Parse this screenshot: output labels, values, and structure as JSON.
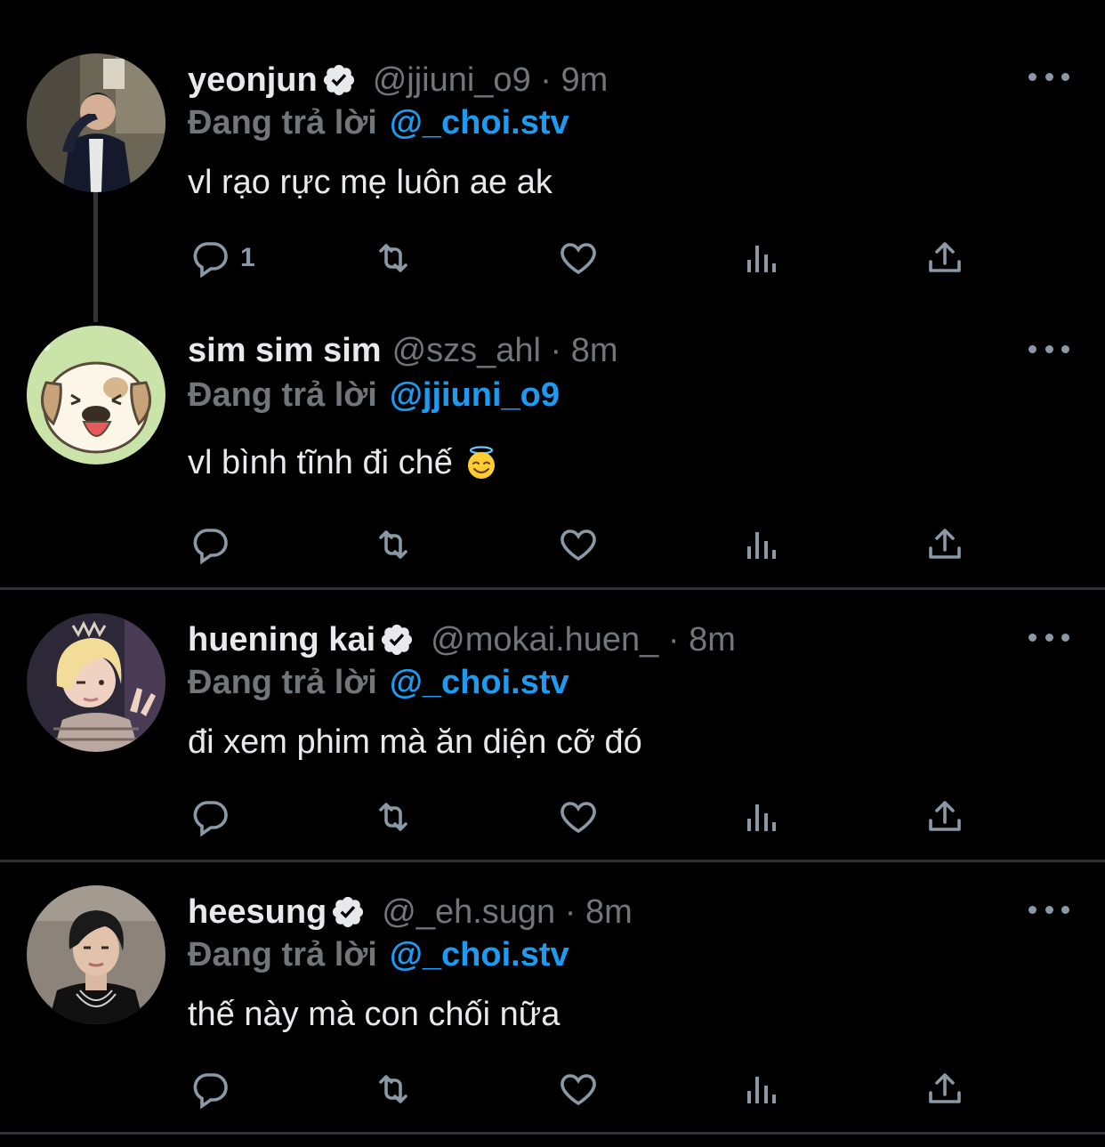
{
  "colors": {
    "background": "#000000",
    "text": "#e7e9ea",
    "muted": "#71767b",
    "icon": "#8b98a5",
    "link": "#1d9bf0",
    "divider": "#2f3336"
  },
  "tweets": [
    {
      "name": "yeonjun",
      "verified": true,
      "handle_meta": "@jjiuni_o9 · 9m",
      "reply_label": "Đang trả lời",
      "reply_to": "@_choi.stv",
      "text": "vl rạo rực mẹ luôn ae ak",
      "reply_count": "1",
      "avatar_icon": "person-photo"
    },
    {
      "name": "sim sim sim",
      "verified": false,
      "handle_meta": "@szs_ahl · 8m",
      "reply_label": "Đang trả lời",
      "reply_to": "@jjiuni_o9",
      "text": "vl bình tĩnh đi chế",
      "emoji": "smiling-face-with-halo",
      "reply_count": "",
      "avatar_icon": "cartoon-dog"
    },
    {
      "name": "huening kai",
      "verified": true,
      "handle_meta": "@mokai.huen_ · 8m",
      "reply_label": "Đang trả lời",
      "reply_to": "@_choi.stv",
      "text": "đi xem phim mà ăn diện cỡ đó",
      "reply_count": "",
      "avatar_icon": "person-photo"
    },
    {
      "name": "heesung",
      "verified": true,
      "handle_meta": "@_eh.sugn · 8m",
      "reply_label": "Đang trả lời",
      "reply_to": "@_choi.stv",
      "text": "thế này mà con chối nữa",
      "reply_count": "",
      "avatar_icon": "person-photo"
    }
  ],
  "action_icons": [
    "reply-icon",
    "retweet-icon",
    "like-icon",
    "views-icon",
    "share-icon"
  ]
}
